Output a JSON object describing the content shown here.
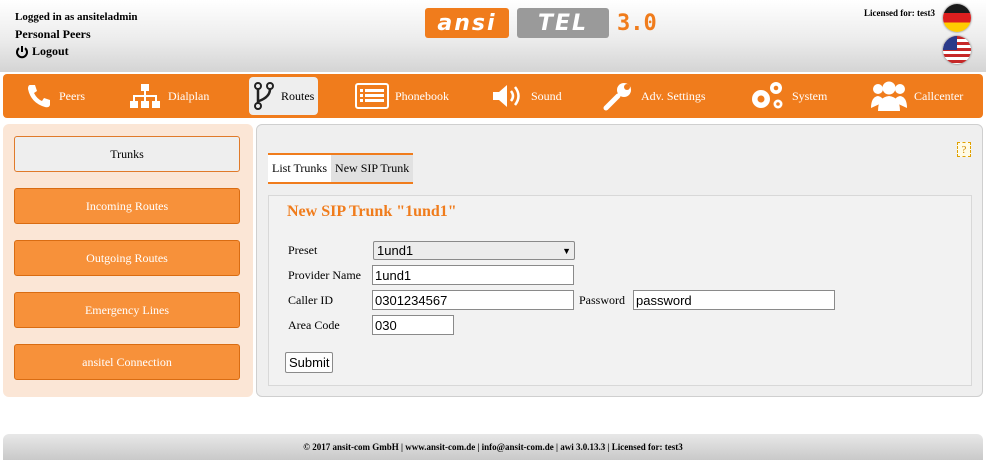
{
  "header": {
    "logged_in": "Logged in as ansiteladmin",
    "section": "Personal Peers",
    "logout": "Logout",
    "logo_left": "ansi",
    "logo_right": "TEL",
    "logo_version": "3.0",
    "licensed": "Licensed for: test3"
  },
  "nav": {
    "items": [
      {
        "label": "Peers",
        "icon": "phone-icon"
      },
      {
        "label": "Dialplan",
        "icon": "sitemap-icon"
      },
      {
        "label": "Routes",
        "icon": "routes-icon"
      },
      {
        "label": "Phonebook",
        "icon": "list-icon"
      },
      {
        "label": "Sound",
        "icon": "speaker-icon"
      },
      {
        "label": "Adv. Settings",
        "icon": "wrench-icon"
      },
      {
        "label": "System",
        "icon": "gears-icon"
      },
      {
        "label": "Callcenter",
        "icon": "users-icon"
      }
    ],
    "active": "Routes"
  },
  "sidebar": {
    "items": [
      {
        "label": "Trunks"
      },
      {
        "label": "Incoming Routes"
      },
      {
        "label": "Outgoing Routes"
      },
      {
        "label": "Emergency Lines"
      },
      {
        "label": "ansitel Connection"
      }
    ],
    "active": "Trunks"
  },
  "main": {
    "help": "?",
    "tabs": [
      {
        "label": "List Trunks"
      },
      {
        "label": "New SIP Trunk"
      }
    ],
    "form": {
      "title": "New SIP Trunk \"1und1\"",
      "preset_label": "Preset",
      "preset_value": "1und1",
      "provider_label": "Provider Name",
      "provider_value": "1und1",
      "caller_label": "Caller ID",
      "caller_value": "0301234567",
      "password_label": "Password",
      "password_value": "password",
      "area_label": "Area Code",
      "area_value": "030",
      "submit": "Submit"
    }
  },
  "footer": {
    "text": "© 2017 ansit-com GmbH | www.ansit-com.de | info@ansit-com.de | awi 3.0.13.3 | Licensed for: test3"
  },
  "colors": {
    "accent": "#f07c1c",
    "sidebar_bg": "#fbe6d6"
  }
}
